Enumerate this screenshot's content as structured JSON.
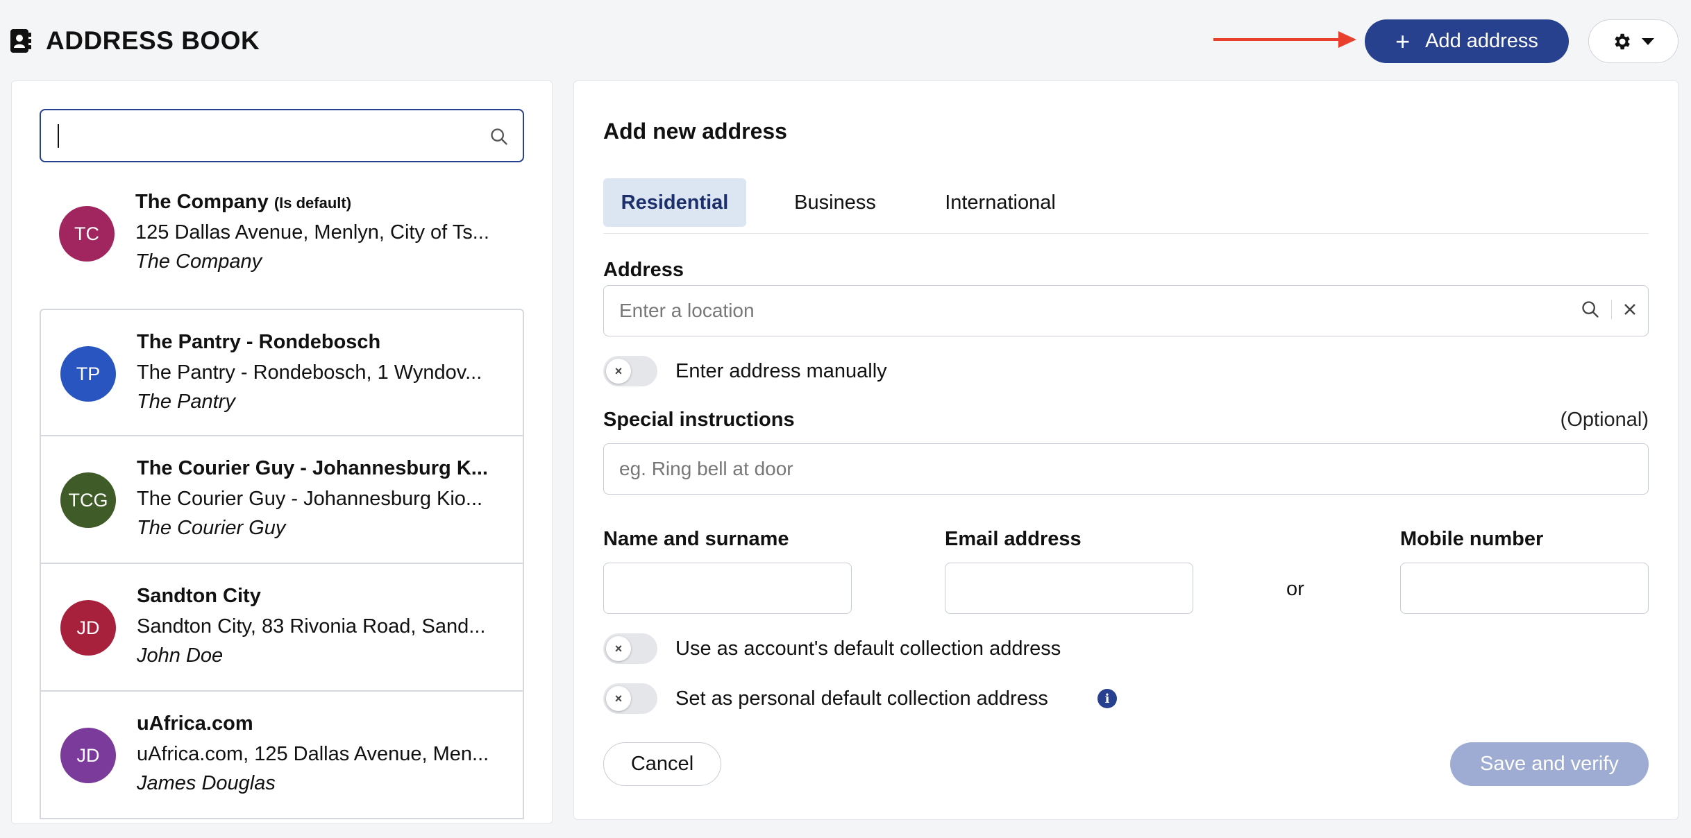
{
  "header": {
    "title": "ADDRESS BOOK",
    "add_button_label": "Add address",
    "arrow_color": "#e8402c",
    "accent_color": "#27418f"
  },
  "sidebar": {
    "search": {
      "value": "",
      "placeholder": ""
    },
    "contacts": [
      {
        "initials": "TC",
        "name": "The Company",
        "default_tag": "(Is default)",
        "address": "125 Dallas Avenue, Menlyn, City of Ts...",
        "organisation": "The Company",
        "avatar_color": "#a1265f"
      },
      {
        "initials": "TP",
        "name": "The Pantry - Rondebosch",
        "default_tag": "",
        "address": "The Pantry - Rondebosch, 1 Wyndov...",
        "organisation": "The Pantry",
        "avatar_color": "#2855c0"
      },
      {
        "initials": "TCG",
        "name": "The Courier Guy - Johannesburg K...",
        "default_tag": "",
        "address": "The Courier Guy - Johannesburg Kio...",
        "organisation": "The Courier Guy",
        "avatar_color": "#3f5b27"
      },
      {
        "initials": "JD",
        "name": "Sandton City",
        "default_tag": "",
        "address": "Sandton City, 83 Rivonia Road, Sand...",
        "organisation": "John Doe",
        "avatar_color": "#a8213c"
      },
      {
        "initials": "JD",
        "name": "uAfrica.com",
        "default_tag": "",
        "address": "uAfrica.com, 125 Dallas Avenue, Men...",
        "organisation": "James Douglas",
        "avatar_color": "#7a3b9b"
      }
    ]
  },
  "form": {
    "title": "Add new address",
    "tabs": [
      {
        "label": "Residential",
        "active": true
      },
      {
        "label": "Business",
        "active": false
      },
      {
        "label": "International",
        "active": false
      }
    ],
    "address_label": "Address",
    "address_placeholder": "Enter a location",
    "manual_toggle_label": "Enter address manually",
    "special_label": "Special instructions",
    "special_optional": "(Optional)",
    "special_placeholder": "eg. Ring bell at door",
    "name_label": "Name and surname",
    "email_label": "Email address",
    "or_text": "or",
    "mobile_label": "Mobile number",
    "name_value": "",
    "email_value": "",
    "mobile_value": "",
    "account_default_label": "Use as account's default collection address",
    "personal_default_label": "Set as personal default collection address",
    "cancel_label": "Cancel",
    "save_label": "Save and verify"
  }
}
